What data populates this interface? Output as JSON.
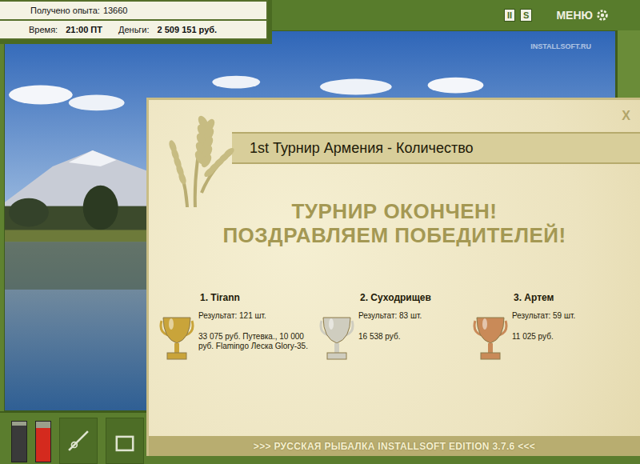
{
  "hud": {
    "experience_label": "Получено опыта:",
    "experience": "13660",
    "time_label": "Время:",
    "time": "21:00 ПТ",
    "money_label": "Деньги:",
    "money": "2 509 151 руб."
  },
  "toolbar": {
    "pause": "II",
    "sound": "S",
    "menu": "МЕНЮ"
  },
  "watermark": "INSTALLSOFT.RU",
  "meters": [
    {
      "level": 0.9,
      "color": "#3a3a3a"
    },
    {
      "level": 0.85,
      "color": "#d42a1e"
    }
  ],
  "dialog": {
    "title": "1st Турнир Армения - Количество",
    "close": "X",
    "headline": [
      "ТУРНИР ОКОНЧЕН!",
      "ПОЗДРАВЛЯЕМ ПОБЕДИТЕЛЕЙ!"
    ],
    "winners": [
      {
        "place": "1. Tirann",
        "result": "Результат: 121 шт.",
        "prize": "33 075 руб. Путевка., 10 000 руб. Flamingo Леска Glory-35.",
        "color": "#c9a43a"
      },
      {
        "place": "2. Суходрищев",
        "result": "Результат: 83 шт.",
        "prize": "16 538 руб.",
        "color": "#cfcdbf"
      },
      {
        "place": "3. Артем",
        "result": "Результат: 59 шт.",
        "prize": "11 025 руб.",
        "color": "#c98a58"
      }
    ],
    "footer": ">>> РУССКАЯ РЫБАЛКА INSTALLSOFT EDITION 3.7.6 <<<"
  }
}
